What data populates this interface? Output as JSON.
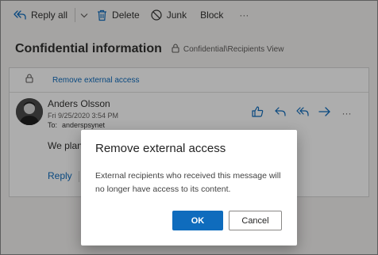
{
  "toolbar": {
    "reply_all": "Reply all",
    "delete": "Delete",
    "junk": "Junk",
    "block": "Block",
    "more": "···"
  },
  "email": {
    "subject": "Confidential information",
    "sensitivity_label": "Confidential\\Recipients View",
    "protection_link": "Remove external access",
    "sender_name": "Anders Olsson",
    "date": "Fri 9/25/2020 3:54 PM",
    "to_label": "To:",
    "to_value": "anderspsynet",
    "body_preview": "We plan",
    "reply_label": "Reply"
  },
  "dialog": {
    "title": "Remove external access",
    "message": "External recipients who received this message will no longer have access to its content.",
    "ok_label": "OK",
    "cancel_label": "Cancel"
  },
  "colors": {
    "accent": "#0f6cbd",
    "icon_accent": "#0f6cbd",
    "overlay": "rgba(0,0,0,0.32)"
  }
}
